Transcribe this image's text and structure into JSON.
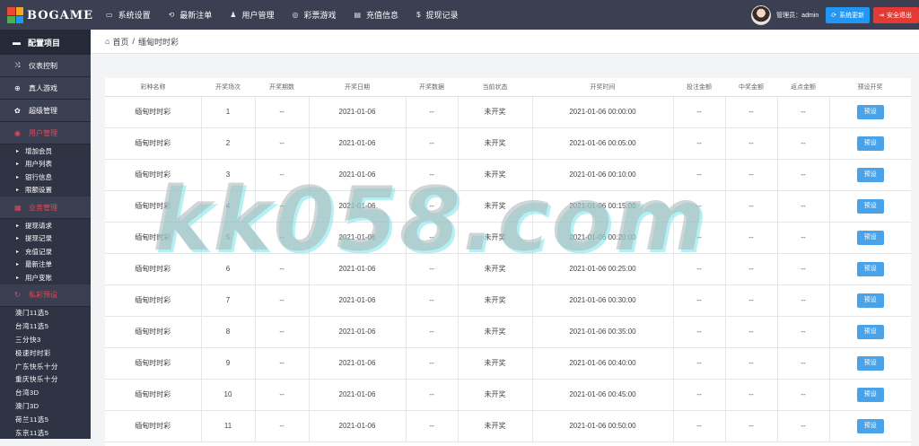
{
  "brand": {
    "name": "BOGAME",
    "colors": [
      "#e8493a",
      "#f5a623",
      "#4caf50",
      "#2196f3"
    ]
  },
  "topnav": [
    {
      "icon": "▭",
      "icon_name": "monitor-icon",
      "label": "系统设置"
    },
    {
      "icon": "⟲",
      "icon_name": "refresh-icon",
      "label": "最新注单"
    },
    {
      "icon": "♟",
      "icon_name": "user-icon",
      "label": "用户管理"
    },
    {
      "icon": "◎",
      "icon_name": "lottery-icon",
      "label": "彩票游戏"
    },
    {
      "icon": "▤",
      "icon_name": "card-icon",
      "label": "充值信息"
    },
    {
      "icon": "$",
      "icon_name": "dollar-icon",
      "label": "提现记录"
    }
  ],
  "topright": {
    "admin": "管理员：admin",
    "update_btn": "系统更新",
    "logout_btn": "安全退出"
  },
  "sidebar": {
    "header": "配置项目",
    "menus": [
      {
        "icon": "⤨",
        "label": "仪表控制"
      },
      {
        "icon": "⊕",
        "label": "真人游戏"
      },
      {
        "icon": "✿",
        "label": "超级管理"
      }
    ],
    "user_menu": {
      "icon": "◉",
      "label": "用户管理"
    },
    "user_subs": [
      "增加会员",
      "用户列表",
      "银行信息",
      "限额设置"
    ],
    "biz_menu": {
      "icon": "▦",
      "label": "业务管理"
    },
    "biz_subs": [
      "提现请求",
      "提现记录",
      "充值记录",
      "最新注单",
      "用户变账"
    ],
    "pre_menu": {
      "icon": "↻",
      "label": "私彩预设"
    },
    "pre_items": [
      "澳门11选5",
      "台湾11选5",
      "三分快3",
      "极速时时彩",
      "广东快乐十分",
      "重庆快乐十分",
      "台湾3D",
      "澳门3D",
      "荷兰11选5",
      "东京11选5"
    ]
  },
  "breadcrumb": {
    "home_icon": "⌂",
    "home": "首页",
    "sep": "/",
    "current": "缅甸时时彩"
  },
  "table": {
    "headers": [
      "彩种名称",
      "开奖场次",
      "开奖期数",
      "开奖日期",
      "开奖数据",
      "当前状态",
      "开奖时间",
      "投注金额",
      "中奖金额",
      "返点金额",
      "预设开奖"
    ],
    "button_label": "预设",
    "rows": [
      [
        "缅甸时时彩",
        "1",
        "--",
        "2021-01-06",
        "--",
        "未开奖",
        "2021-01-06 00:00:00",
        "--",
        "--",
        "--"
      ],
      [
        "缅甸时时彩",
        "2",
        "--",
        "2021-01-06",
        "--",
        "未开奖",
        "2021-01-06 00:05:00",
        "--",
        "--",
        "--"
      ],
      [
        "缅甸时时彩",
        "3",
        "--",
        "2021-01-06",
        "--",
        "未开奖",
        "2021-01-06 00:10:00",
        "--",
        "--",
        "--"
      ],
      [
        "缅甸时时彩",
        "4",
        "--",
        "2021-01-06",
        "--",
        "未开奖",
        "2021-01-06 00:15:00",
        "--",
        "--",
        "--"
      ],
      [
        "缅甸时时彩",
        "5",
        "--",
        "2021-01-06",
        "--",
        "未开奖",
        "2021-01-06 00:20:00",
        "--",
        "--",
        "--"
      ],
      [
        "缅甸时时彩",
        "6",
        "--",
        "2021-01-06",
        "--",
        "未开奖",
        "2021-01-06 00:25:00",
        "--",
        "--",
        "--"
      ],
      [
        "缅甸时时彩",
        "7",
        "--",
        "2021-01-06",
        "--",
        "未开奖",
        "2021-01-06 00:30:00",
        "--",
        "--",
        "--"
      ],
      [
        "缅甸时时彩",
        "8",
        "--",
        "2021-01-06",
        "--",
        "未开奖",
        "2021-01-06 00:35:00",
        "--",
        "--",
        "--"
      ],
      [
        "缅甸时时彩",
        "9",
        "--",
        "2021-01-06",
        "--",
        "未开奖",
        "2021-01-06 00:40:00",
        "--",
        "--",
        "--"
      ],
      [
        "缅甸时时彩",
        "10",
        "--",
        "2021-01-06",
        "--",
        "未开奖",
        "2021-01-06 00:45:00",
        "--",
        "--",
        "--"
      ],
      [
        "缅甸时时彩",
        "11",
        "--",
        "2021-01-06",
        "--",
        "未开奖",
        "2021-01-06 00:50:00",
        "--",
        "--",
        "--"
      ]
    ]
  },
  "watermark": "kk058.com"
}
